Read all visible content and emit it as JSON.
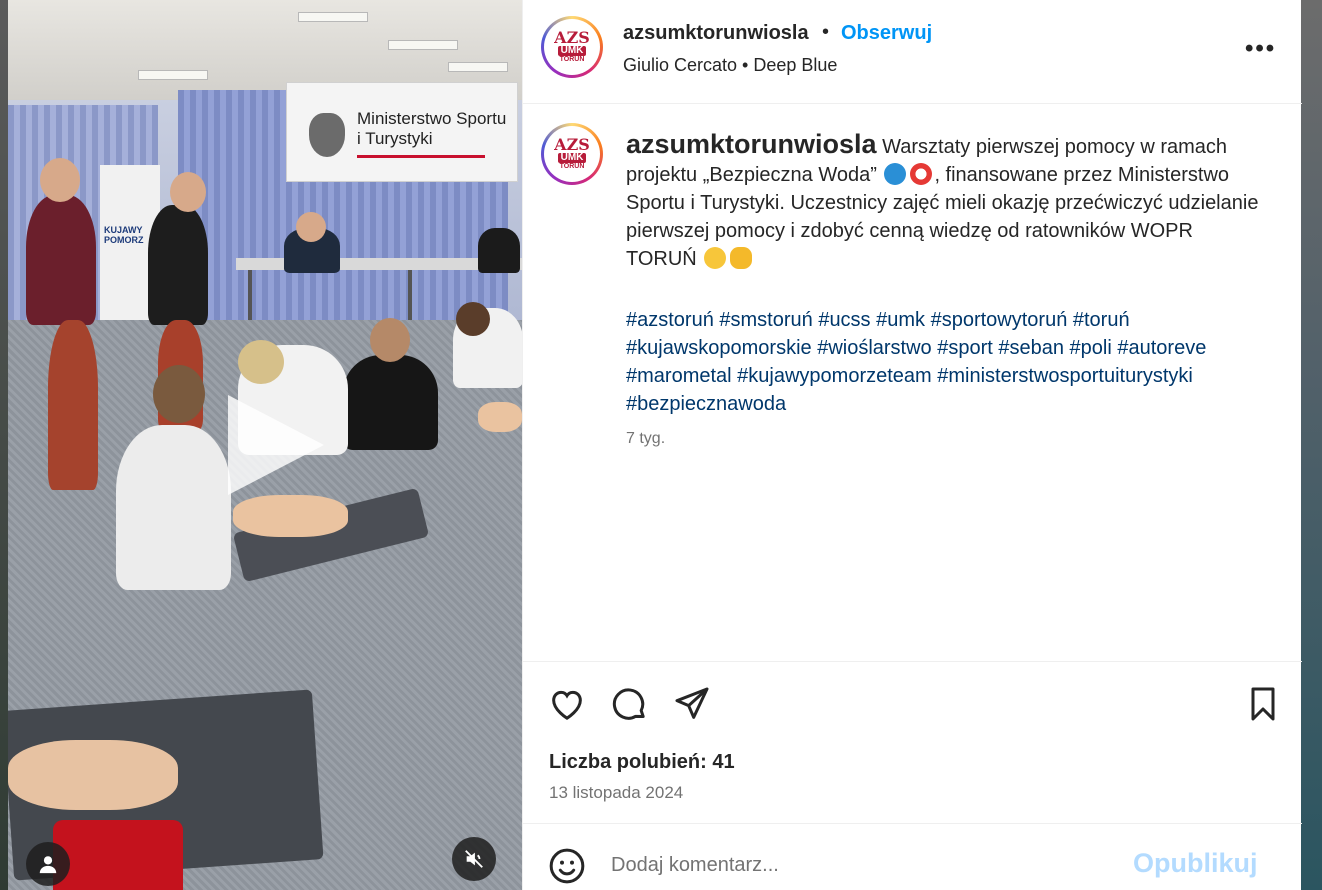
{
  "post": {
    "username": "azsumktorunwiosla",
    "follow_label": "Obserwuj",
    "separator": "•",
    "audio": "Giulio Cercato • Deep Blue",
    "more_label": "•••",
    "caption_text_1": " Warsztaty pierwszej pomocy w ramach projektu „Bezpieczna Woda”",
    "caption_text_2": ", finansowane przez Ministerstwo Sportu i Turystyki. Uczestnicy zajęć mieli okazję przećwiczyć udzielanie pierwszej pomocy i zdobyć cenną wiedzę od ratowników WOPR TORUŃ",
    "hashtags": "#azstoruń #smstoruń #ucss #umk #sportowytoruń #toruń #kujawskopomorskie #wioślarstwo #sport #seban #poli #autoreve #marometal #kujawypomorzeteam #ministerstwosportuiturystyki #bezpiecznawoda",
    "age": "7 tyg.",
    "likes": "Liczba polubień: 41",
    "date": "13 listopada 2024"
  },
  "logo": {
    "mark": "AZS",
    "umk": "UMK",
    "city": "TORUŃ"
  },
  "media_scene": {
    "banner_text": "Ministerstwo Sportu i Turystyki",
    "rollup_text": "KUJAWY POMORZ"
  },
  "comment": {
    "placeholder": "Dodaj komentarz...",
    "publish_label": "Opublikuj"
  },
  "colors": {
    "link_blue": "#0095f6",
    "hashtag": "#00376b",
    "publish_disabled": "#b3dbff"
  },
  "icons": [
    "heart-icon",
    "comment-icon",
    "share-icon",
    "bookmark-icon",
    "emoji-icon",
    "play-icon",
    "muted-icon",
    "user-tag-icon",
    "more-icon"
  ]
}
